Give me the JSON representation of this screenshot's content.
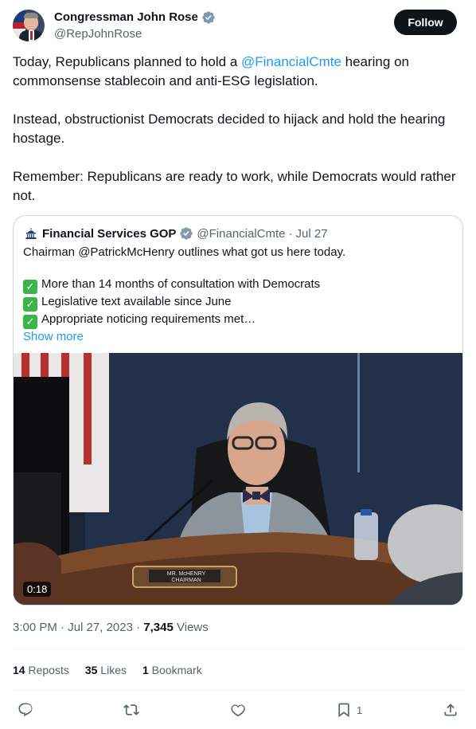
{
  "author": {
    "display_name": "Congressman John Rose",
    "handle": "@RepJohnRose",
    "follow_label": "Follow"
  },
  "tweet": {
    "para1_prefix": "Today, Republicans planned to hold a ",
    "para1_mention": "@FinancialCmte",
    "para1_suffix": " hearing on commonsense stablecoin and anti-ESG legislation.",
    "para2": "Instead, obstructionist Democrats decided to hijack and hold the hearing hostage.",
    "para3": "Remember: Republicans are ready to work, while Democrats would rather not."
  },
  "quote": {
    "display_name": "Financial Services GOP",
    "handle": "@FinancialCmte",
    "separator": "·",
    "date": "Jul 27",
    "line1": "Chairman @PatrickMcHenry outlines what got us here today.",
    "items": [
      "More than 14 months of consultation with Democrats",
      "Legislative text available since June",
      "Appropriate noticing requirements met…"
    ],
    "show_more": "Show more",
    "video": {
      "duration": "0:18",
      "nameplate_line1": "MR. McHENRY",
      "nameplate_line2": "CHAIRMAN"
    }
  },
  "meta": {
    "time": "3:00 PM",
    "separator": "·",
    "date": "Jul 27, 2023",
    "views_count": "7,345",
    "views_label": "Views"
  },
  "stats": {
    "reposts_count": "14",
    "reposts_label": "Reposts",
    "likes_count": "35",
    "likes_label": "Likes",
    "bookmarks_count": "1",
    "bookmarks_label": "Bookmark"
  },
  "actions": {
    "bookmark_count": "1"
  },
  "colors": {
    "link": "#1d9bf0",
    "verified": "#829aab",
    "text": "#0f1419",
    "secondary": "#536471"
  }
}
